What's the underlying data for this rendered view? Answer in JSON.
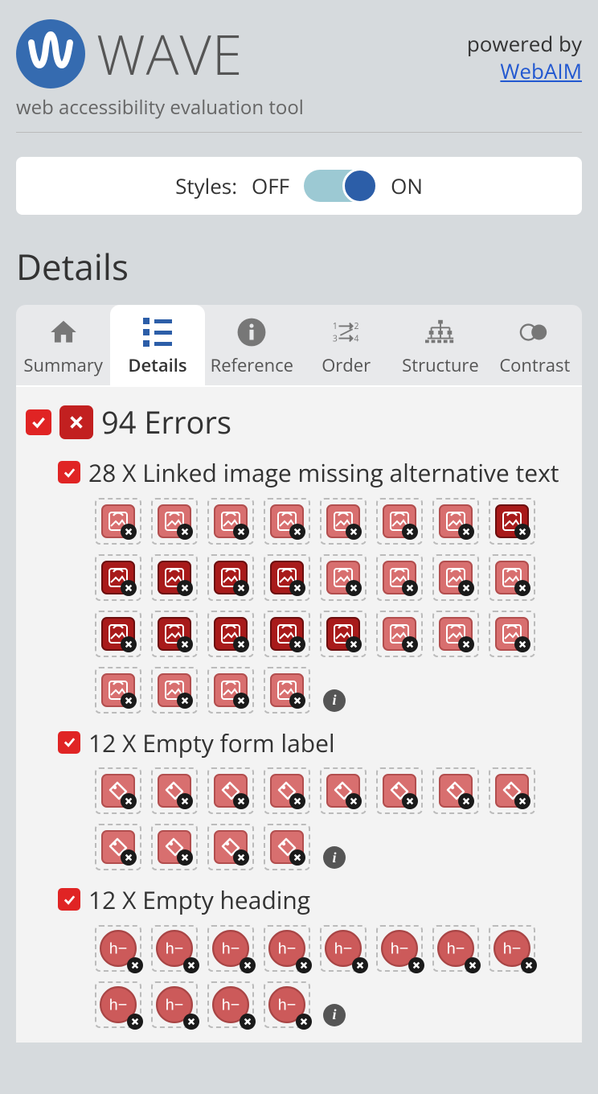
{
  "header": {
    "brand_name": "WAVE",
    "subtitle": "web accessibility evaluation tool",
    "powered_by_text": "powered by",
    "powered_by_link": "WebAIM"
  },
  "styles_toggle": {
    "label": "Styles:",
    "off": "OFF",
    "on": "ON",
    "state": "on"
  },
  "section_title": "Details",
  "tabs": [
    {
      "id": "summary",
      "label": "Summary"
    },
    {
      "id": "details",
      "label": "Details"
    },
    {
      "id": "reference",
      "label": "Reference"
    },
    {
      "id": "order",
      "label": "Order"
    },
    {
      "id": "structure",
      "label": "Structure"
    },
    {
      "id": "contrast",
      "label": "Contrast"
    }
  ],
  "active_tab": "details",
  "errors": {
    "total_label": "94 Errors",
    "groups": [
      {
        "label": "28 X Linked image missing alternative text",
        "icon_type": "image",
        "items": [
          "light",
          "light",
          "light",
          "light",
          "light",
          "light",
          "light",
          "dark",
          "dark",
          "dark",
          "dark",
          "dark",
          "light",
          "light",
          "light",
          "light",
          "dark",
          "dark",
          "dark",
          "dark",
          "dark",
          "light",
          "light",
          "light",
          "light",
          "light",
          "light",
          "light"
        ]
      },
      {
        "label": "12 X Empty form label",
        "icon_type": "label",
        "items": [
          "light",
          "light",
          "light",
          "light",
          "light",
          "light",
          "light",
          "light",
          "light",
          "light",
          "light",
          "light"
        ]
      },
      {
        "label": "12 X Empty heading",
        "icon_type": "heading",
        "items": [
          "light",
          "light",
          "light",
          "light",
          "light",
          "light",
          "light",
          "light",
          "light",
          "light",
          "light",
          "light"
        ]
      }
    ]
  }
}
